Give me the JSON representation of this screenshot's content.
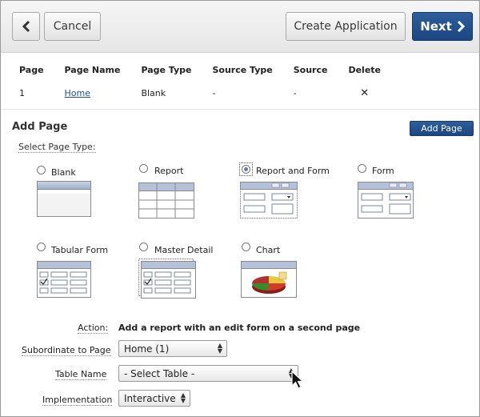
{
  "toolbar": {
    "back_label": "‹",
    "cancel_label": "Cancel",
    "create_label": "Create Application",
    "next_label": "Next"
  },
  "pages_table": {
    "headers": [
      "Page",
      "Page Name",
      "Page Type",
      "Source Type",
      "Source",
      "Delete"
    ],
    "rows": [
      {
        "page": "1",
        "name": "Home",
        "type": "Blank",
        "source_type": "-",
        "source": "-",
        "delete": "✕"
      }
    ]
  },
  "add_page": {
    "title": "Add Page",
    "button_label": "Add Page",
    "select_type_label": "Select Page Type:",
    "page_types": [
      {
        "label": "Blank",
        "selected": false
      },
      {
        "label": "Report",
        "selected": false
      },
      {
        "label": "Report and Form",
        "selected": true
      },
      {
        "label": "Form",
        "selected": false
      },
      {
        "label": "Tabular Form",
        "selected": false
      },
      {
        "label": "Master Detail",
        "selected": false
      },
      {
        "label": "Chart",
        "selected": false
      }
    ]
  },
  "form": {
    "action_label": "Action:",
    "action_text": "Add a report with an edit form on a second page",
    "subordinate_label": "Subordinate to Page",
    "subordinate_value": "Home (1)",
    "table_label": "Table Name",
    "table_value": "- Select Table -",
    "implementation_label": "Implementation",
    "implementation_value": "Interactive"
  },
  "colors": {
    "primary_button": "#1b4682",
    "thumb_header": "#9fb0cc",
    "link": "#1f4f8c"
  },
  "icons": {
    "back": "chevron-left-icon",
    "next": "chevron-right-icon",
    "delete": "close-icon",
    "cursor": "mouse-pointer-icon"
  }
}
